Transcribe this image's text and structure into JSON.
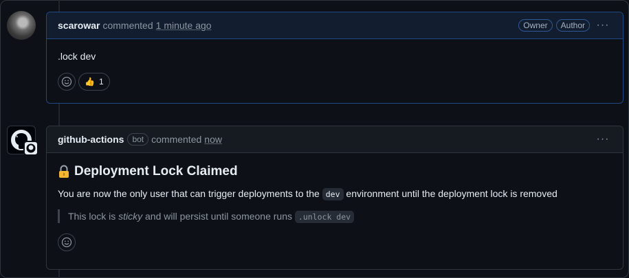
{
  "comments": [
    {
      "author": "scarowar",
      "action": "commented",
      "time": "1 minute ago",
      "labels": [
        "Owner",
        "Author"
      ],
      "body": ".lock dev",
      "reactions": [
        {
          "icon": "thumbs-up-icon",
          "glyph": "👍",
          "count": "1"
        }
      ],
      "accent": "#1f6feb"
    },
    {
      "author": "github-actions",
      "bot_label": "bot",
      "action": "commented",
      "time": "now",
      "heading_icon": "lock-icon",
      "heading": "Deployment Lock Claimed",
      "para_before": "You are now the only user that can trigger deployments to the",
      "para_code": "dev",
      "para_after": "environment until the deployment lock is removed",
      "quote_before": "This lock is",
      "quote_em": "sticky",
      "quote_mid": "and will persist until someone runs",
      "quote_code": ".unlock dev"
    }
  ],
  "menu_glyph": "···"
}
